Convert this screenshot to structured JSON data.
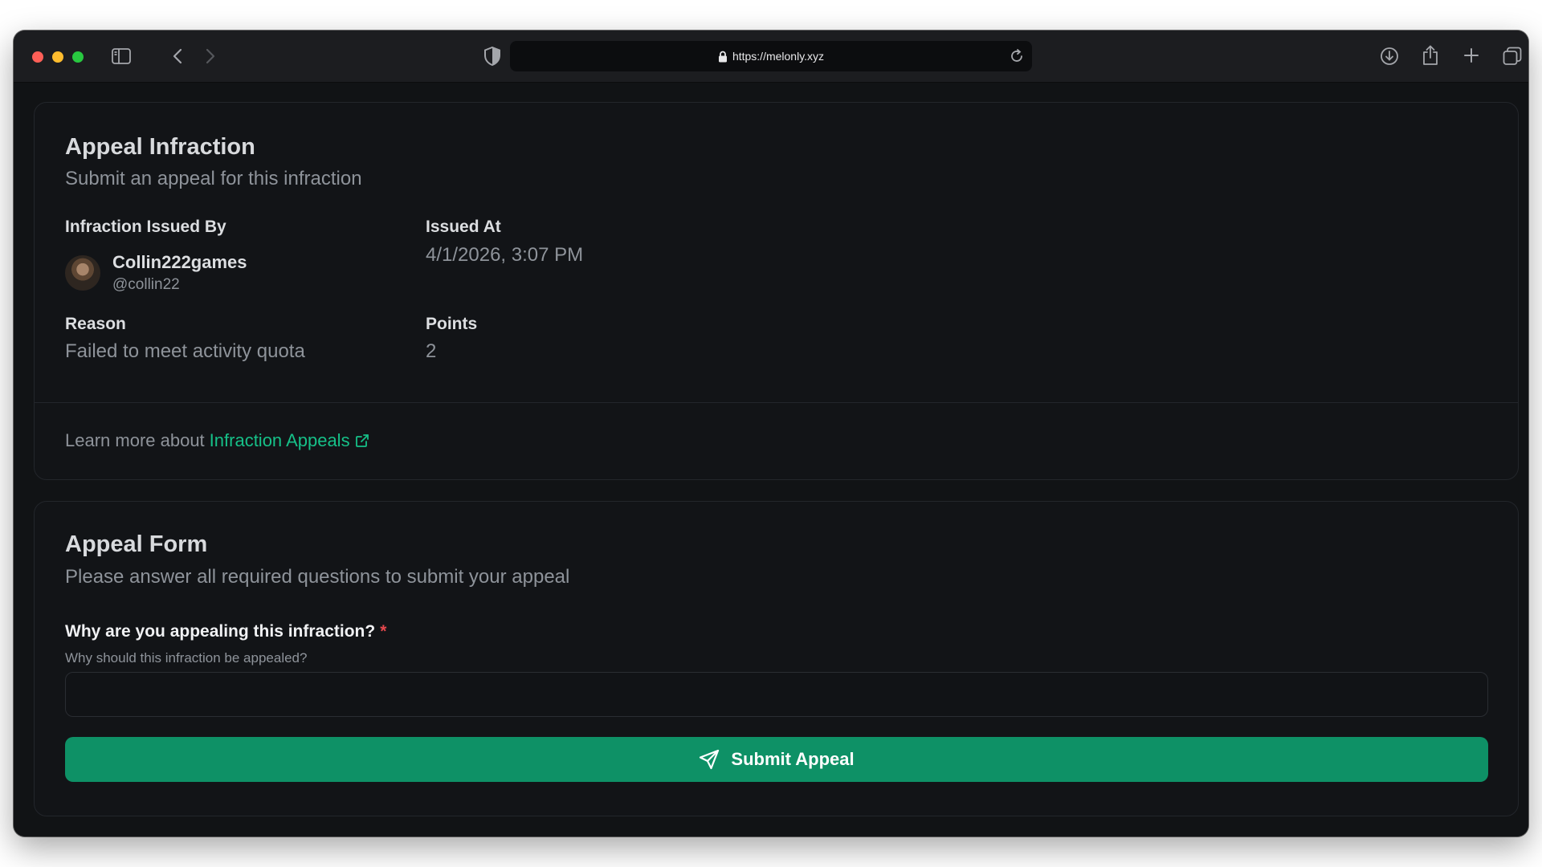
{
  "browser": {
    "url": "https://melonly.xyz",
    "traffic_lights": {
      "close": "#fe5f57",
      "minimize": "#febc2e",
      "maximize": "#28c840"
    }
  },
  "infraction_card": {
    "title": "Appeal Infraction",
    "subtitle": "Submit an appeal for this infraction",
    "issued_by_label": "Infraction Issued By",
    "issuer_name": "Collin222games",
    "issuer_handle": "@collin22",
    "issued_at_label": "Issued At",
    "issued_at_value": "4/1/2026, 3:07 PM",
    "reason_label": "Reason",
    "reason_value": "Failed to meet activity quota",
    "points_label": "Points",
    "points_value": "2",
    "learn_more_prefix": "Learn more about",
    "learn_more_link": "Infraction Appeals"
  },
  "appeal_form": {
    "title": "Appeal Form",
    "subtitle": "Please answer all required questions to submit your appeal",
    "question_label": "Why are you appealing this infraction?",
    "required_marker": "*",
    "question_hint": "Why should this infraction be appealed?",
    "answer_value": "",
    "submit_label": "Submit Appeal"
  },
  "colors": {
    "accent_green": "#0e9166",
    "link_green": "#16c088",
    "required_red": "#e5484d",
    "page_background": "#111315"
  }
}
